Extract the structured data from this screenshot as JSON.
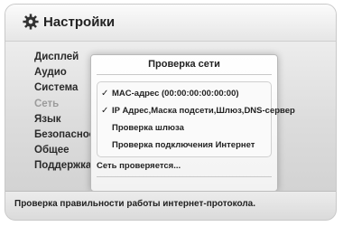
{
  "header": {
    "title": "Настройки",
    "icon": "gear-icon"
  },
  "sidebar": {
    "items": [
      {
        "label": "Дисплей"
      },
      {
        "label": "Аудио"
      },
      {
        "label": "Система"
      },
      {
        "label": "Сеть",
        "disabled": true
      },
      {
        "label": "Язык"
      },
      {
        "label": "Безопасность"
      },
      {
        "label": "Общее"
      },
      {
        "label": "Поддержка"
      }
    ]
  },
  "dialog": {
    "title": "Проверка сети",
    "checks": [
      {
        "label": "MAC-адрес (00:00:00:00:00:00)",
        "checked": true,
        "mark": "✓"
      },
      {
        "label": "IP Адрес,Маска подсети,Шлюз,DNS-сервер",
        "checked": true,
        "mark": "✓"
      },
      {
        "label": "Проверка шлюза",
        "checked": false,
        "mark": ""
      },
      {
        "label": "Проверка подключения Интернет",
        "checked": false,
        "mark": ""
      }
    ],
    "status": "Сеть проверяется..."
  },
  "help": {
    "text": "Проверка правильности работы интернет-протокола."
  }
}
